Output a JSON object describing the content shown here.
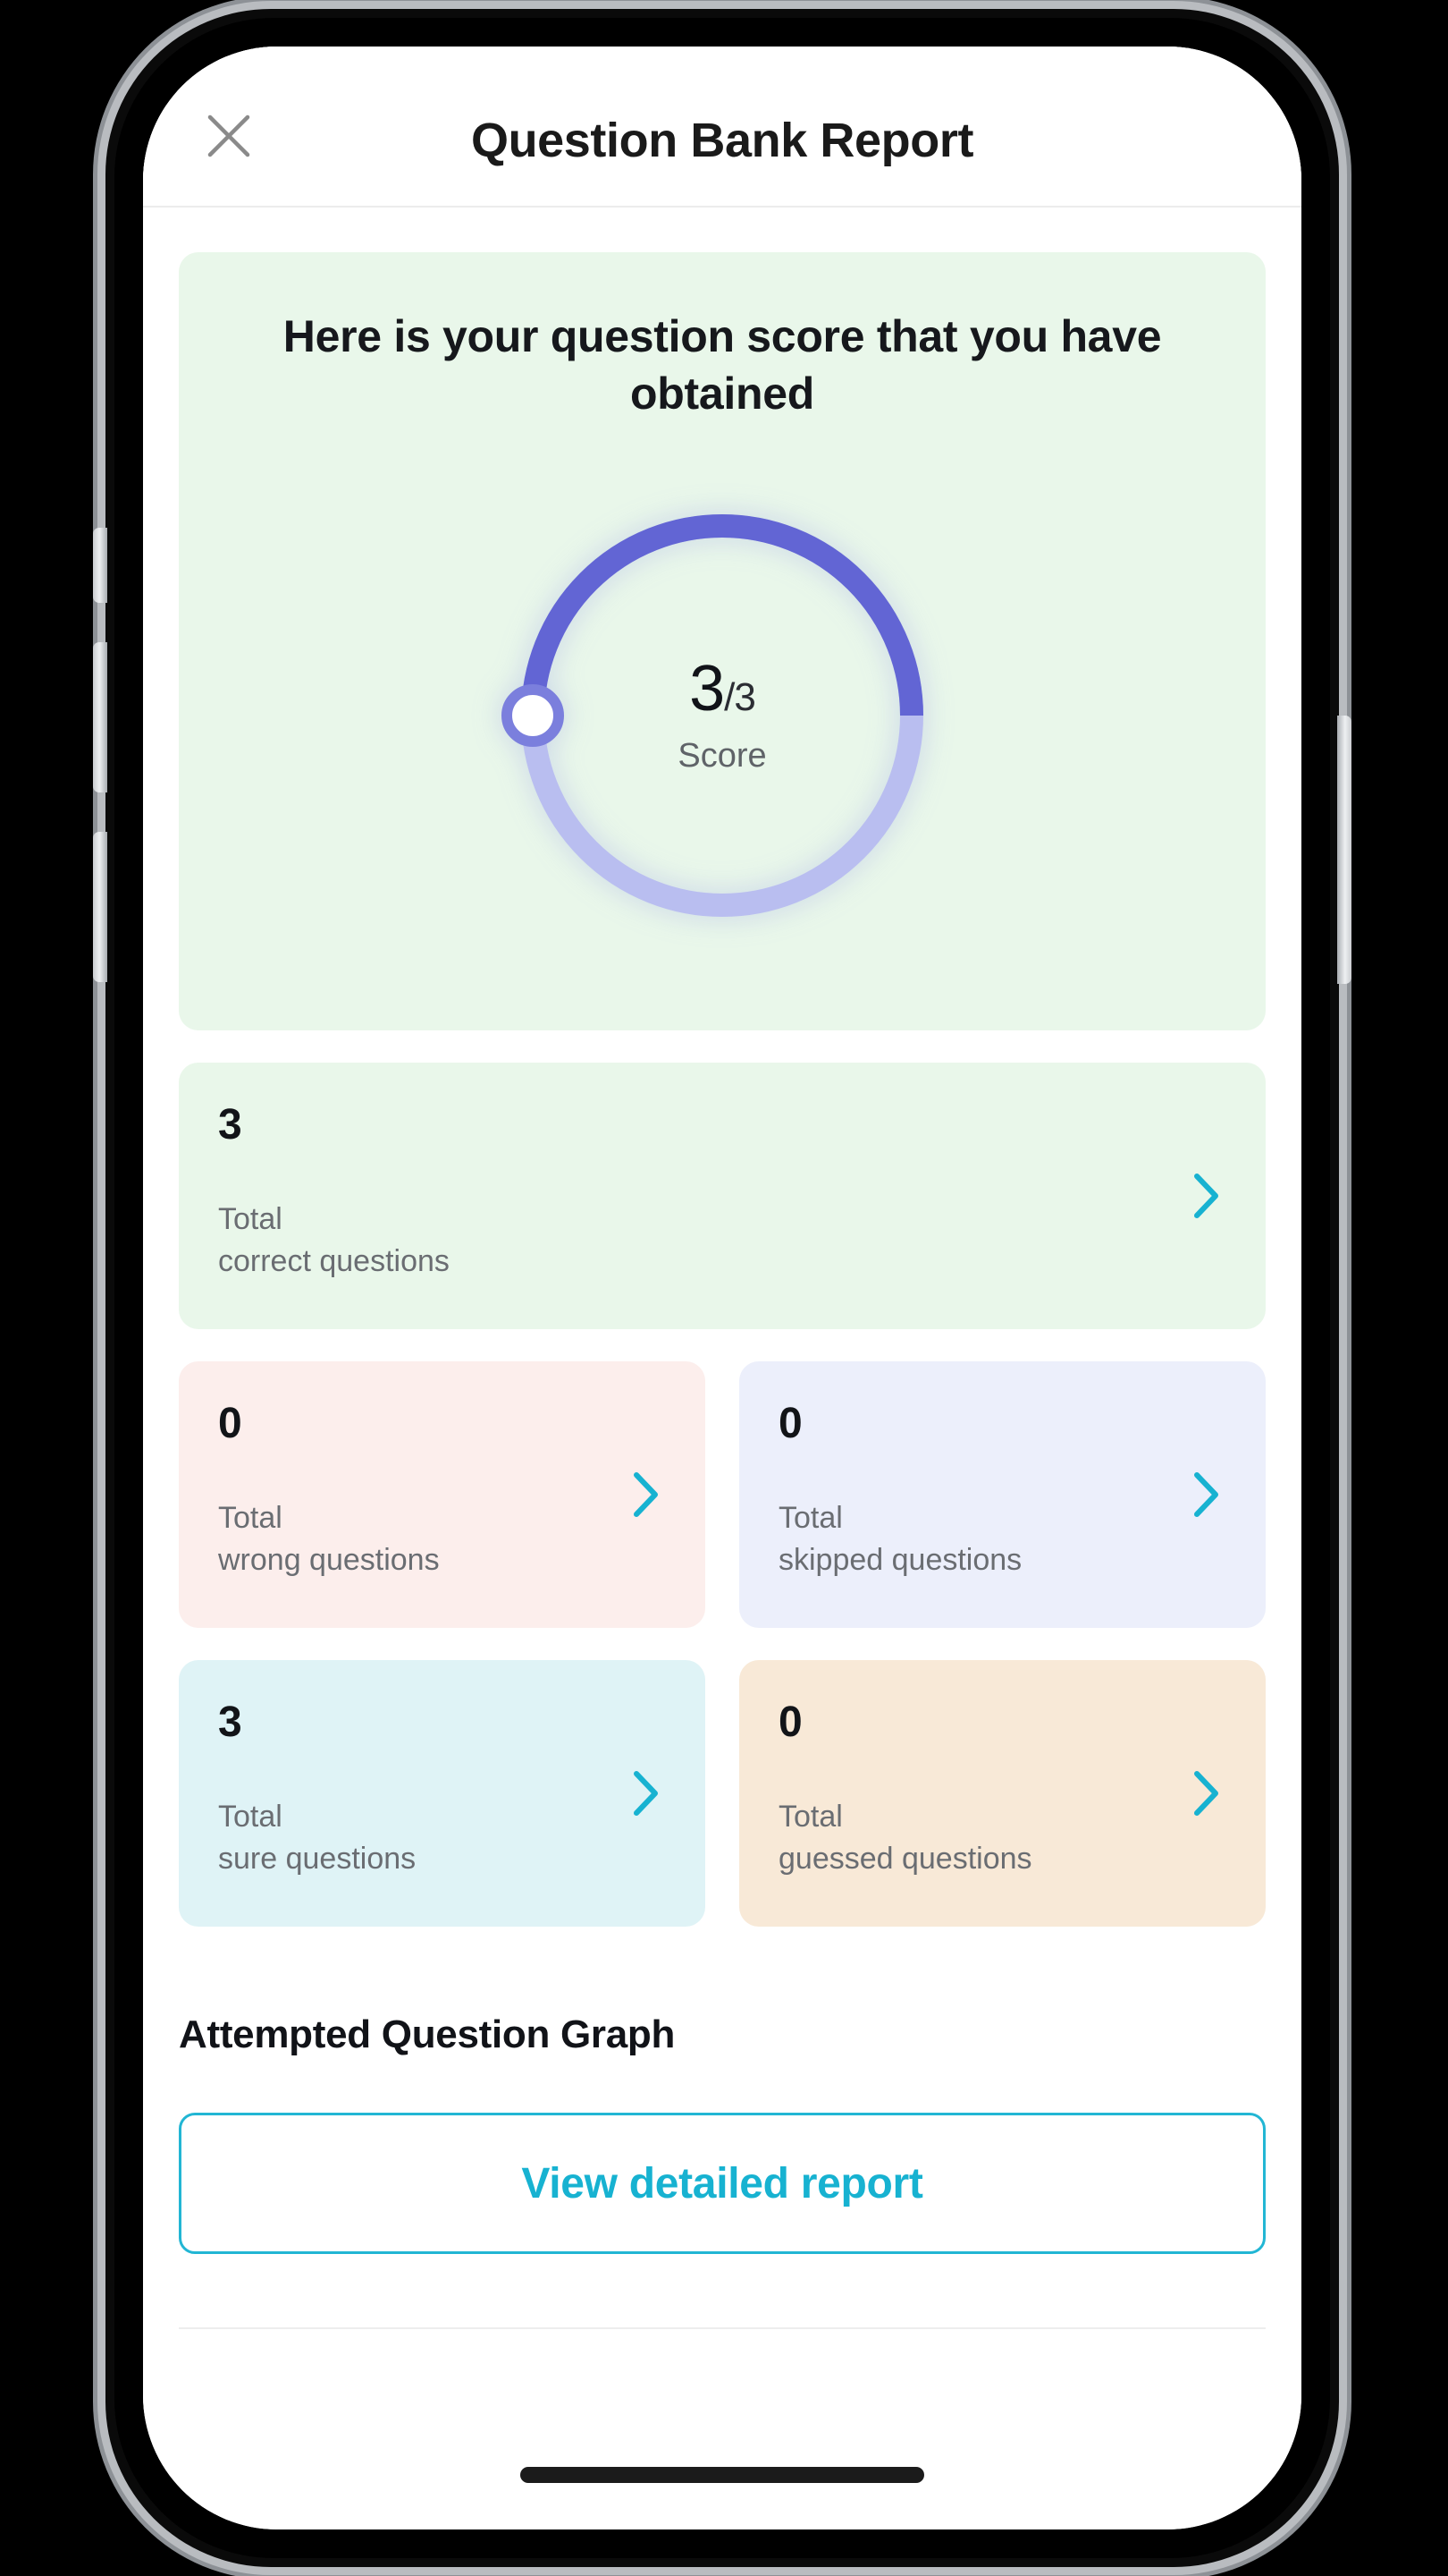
{
  "header": {
    "title": "Question Bank Report",
    "close_icon": "close-x-icon"
  },
  "score_card": {
    "heading": "Here is your question score that you have obtained",
    "score_value": "3",
    "score_separator": "/",
    "score_total": "3",
    "score_label": "Score",
    "background": "#e9f7ea"
  },
  "gauge": {
    "value": 3,
    "max": 3,
    "track_color": "#b9bef0",
    "progress_color": "#6265d4",
    "knob_fill": "#ffffff",
    "knob_ring": "#7b7fdd",
    "start_angle_deg": 180,
    "sweep_deg": 180
  },
  "stats": {
    "correct": {
      "value": "3",
      "label_line1": "Total",
      "label_line2": "correct questions",
      "background": "#e9f7ea",
      "chevron_icon": "chevron-right-icon"
    },
    "wrong": {
      "value": "0",
      "label_line1": "Total",
      "label_line2": "wrong questions",
      "background": "#fceeec",
      "chevron_icon": "chevron-right-icon"
    },
    "skipped": {
      "value": "0",
      "label_line1": "Total",
      "label_line2": "skipped questions",
      "background": "#eceffb",
      "chevron_icon": "chevron-right-icon"
    },
    "sure": {
      "value": "3",
      "label_line1": "Total",
      "label_line2": "sure questions",
      "background": "#dff3f6",
      "chevron_icon": "chevron-right-icon"
    },
    "guessed": {
      "value": "0",
      "label_line1": "Total",
      "label_line2": "guessed questions",
      "background": "#f8e9d7",
      "chevron_icon": "chevron-right-icon"
    }
  },
  "graph_section": {
    "heading": "Attempted Question Graph",
    "view_report_label": "View detailed report"
  },
  "colors": {
    "accent_cyan": "#17b2d1",
    "chevron_cyan": "#17b2d1",
    "text_primary": "#121418",
    "text_secondary": "#6a6d72"
  }
}
